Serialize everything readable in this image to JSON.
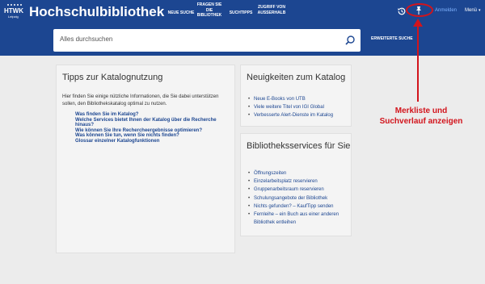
{
  "header": {
    "logo_text": "HTWK",
    "logo_sub": "Leipzig",
    "title": "Hochschulbibliothek",
    "nav": [
      {
        "label": "NEUE SUCHE"
      },
      {
        "label": "FRAGEN SIE DIE BIBLIOTHEK"
      },
      {
        "label": "SUCHTIPPS"
      },
      {
        "label": "ZUGRIFF VON AUSSERHALB"
      }
    ],
    "login": "Anmelden",
    "menu": "Menü",
    "icons": [
      "history-icon",
      "pin-icon",
      "chevron-down-icon"
    ]
  },
  "search": {
    "placeholder": "Alles durchsuchen",
    "advanced": "ERWEITERTE SUCHE"
  },
  "tips_panel": {
    "heading": "Tipps zur Katalognutzung",
    "intro": "Hier finden Sie einige nützliche Informationen, die Sie dabei unterstützen sollen, den Bibliothekskatalog optimal zu nutzen.",
    "links": [
      "Was finden Sie im Katalog?",
      "Welche Services bietet Ihnen der Katalog über die Recherche hinaus?",
      "Wie können Sie Ihre Rechercheergebnisse optimieren?",
      "Was können Sie tun, wenn Sie nichts finden?",
      "Glossar einzelner Katalogfunktionen"
    ]
  },
  "news_panel": {
    "heading": "Neuigkeiten zum Katalog",
    "items": [
      "Neue E-Books von UTB",
      "Viele weitere Titel von IGI Global",
      "Verbesserte Alert-Dienste im Katalog"
    ]
  },
  "services_panel": {
    "heading": "Bibliotheksservices für Sie",
    "items": [
      "Öffnungszeiten",
      "Einzelarbeitsplatz reservieren",
      "Gruppenarbeitsraum reservieren",
      "Schulungsangebote der Bibliothek",
      "Nichts gefunden? – KaufTipp senden",
      "Fernleihe – ein Buch aus einer anderen Bibliothek entleihen"
    ]
  },
  "annotation": {
    "text": "Merkliste und Suchverlauf anzeigen",
    "color": "#d2141c"
  },
  "colors": {
    "brand": "#1c4691",
    "background": "#ececec",
    "panel": "#f4f4f4",
    "link": "#1c4691",
    "login": "#7fb3ff"
  }
}
